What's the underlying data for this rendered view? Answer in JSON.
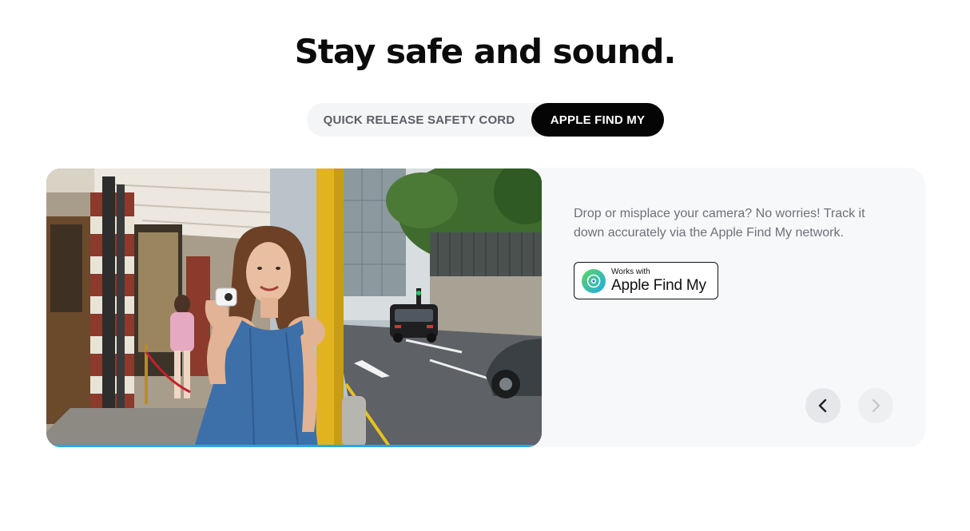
{
  "headline": "Stay safe and sound.",
  "tabs": [
    {
      "label": "QUICK RELEASE SAFETY CORD",
      "active": false
    },
    {
      "label": "APPLE FIND MY",
      "active": true
    }
  ],
  "feature": {
    "description": "Drop or misplace your camera? No worries! Track it down accurately via the Apple Find My network.",
    "badge": {
      "small_text": "Works with",
      "big_text": "Apple Find My",
      "icon": "find-my-icon"
    },
    "slide_progress": 1.0
  },
  "carousel": {
    "prev_icon": "chevron-left-icon",
    "next_icon": "chevron-right-icon"
  },
  "colors": {
    "accent": "#27a7e8",
    "active_tab": "#050505",
    "panel": "#f7f8fa"
  }
}
